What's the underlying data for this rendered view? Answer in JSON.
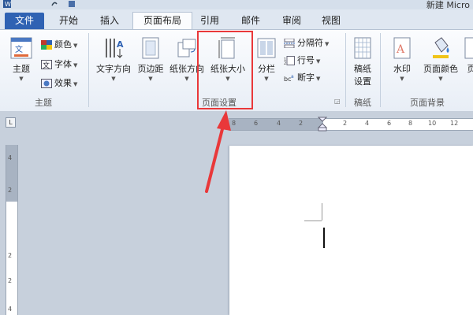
{
  "window": {
    "title": "新建 Micro"
  },
  "tabs": [
    {
      "label": "文件"
    },
    {
      "label": "开始"
    },
    {
      "label": "插入"
    },
    {
      "label": "页面布局"
    },
    {
      "label": "引用"
    },
    {
      "label": "邮件"
    },
    {
      "label": "审阅"
    },
    {
      "label": "视图"
    }
  ],
  "active_tab": "页面布局",
  "ribbon": {
    "theme_group": {
      "label": "主题",
      "theme_button": "主题",
      "colors": "颜色",
      "fonts": "字体",
      "effects": "效果"
    },
    "page_setup_group": {
      "label": "页面设置",
      "text_direction": "文字方向",
      "margins": "页边距",
      "orientation": "纸张方向",
      "size": "纸张大小",
      "columns": "分栏",
      "breaks": "分隔符",
      "line_numbers": "行号",
      "hyphenation": "断字"
    },
    "draft_group": {
      "label": "稿纸",
      "draft_settings_line1": "稿纸",
      "draft_settings_line2": "设置"
    },
    "background_group": {
      "label": "页面背景",
      "watermark": "水印",
      "page_color": "页面颜色",
      "page_border": "页"
    }
  },
  "ruler": {
    "corner_symbol": "L",
    "h_ticks": [
      "8",
      "6",
      "4",
      "2",
      "2",
      "4",
      "6",
      "8",
      "10",
      "12"
    ],
    "v_ticks": [
      "4",
      "2",
      "2",
      "2",
      "4"
    ]
  },
  "colors": {
    "accent": "#2f62b3",
    "highlight": "#e9383a"
  }
}
